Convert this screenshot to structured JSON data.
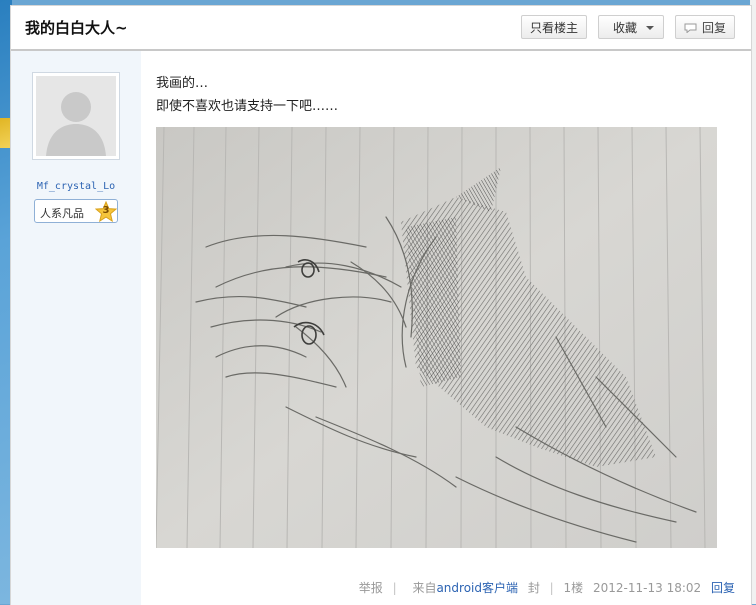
{
  "header": {
    "title": "我的白白大人~",
    "only_op_label": "只看楼主",
    "favorite_label": "收藏",
    "reply_label": "回复"
  },
  "author": {
    "username": "Mf_crystal_Lo",
    "level_title": "人系凡品",
    "level_number": "3"
  },
  "post": {
    "lines": [
      "我画的…",
      "即使不喜欢也请支持一下吧……"
    ]
  },
  "footer": {
    "report_label": "举报",
    "from_prefix": "来自",
    "client_name": "android客户端",
    "block_label": "封",
    "floor": "1楼",
    "datetime": "2012-11-13 18:02",
    "reply_label": "回复"
  }
}
